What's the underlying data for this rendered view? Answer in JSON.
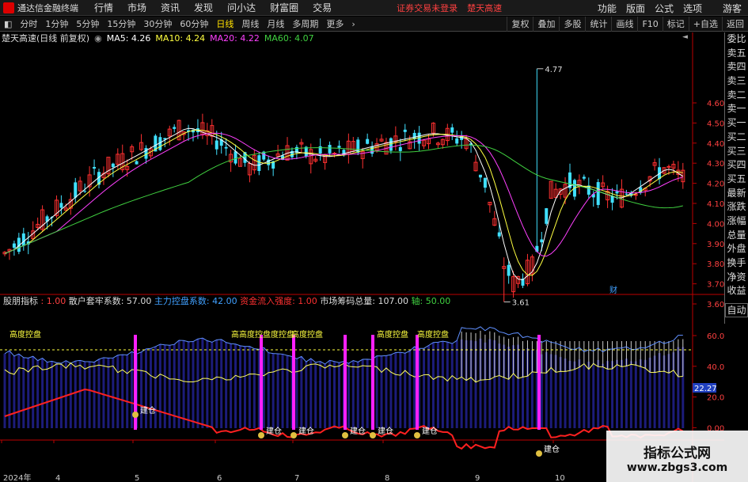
{
  "app_title": "通达信金融终端",
  "menus": [
    "行情",
    "市场",
    "资讯",
    "发现",
    "问小达",
    "财富圈",
    "交易"
  ],
  "notices": [
    "证券交易未登录",
    "楚天高速"
  ],
  "menus_right": [
    "功能",
    "版面",
    "公式",
    "选项",
    "游客"
  ],
  "tabs": [
    "分时",
    "1分钟",
    "5分钟",
    "15分钟",
    "30分钟",
    "60分钟",
    "日线",
    "周线",
    "月线",
    "多周期",
    "更多"
  ],
  "tabs_right": [
    "复权",
    "叠加",
    "多股",
    "统计",
    "画线",
    "F10",
    "标记",
    "+自选",
    "返回"
  ],
  "stock_name": "楚天高速",
  "period_info": "(日线 前复权)",
  "ma": {
    "ma5": "MA5: 4.26",
    "ma10": "MA10: 4.24",
    "ma20": "MA20: 4.22",
    "ma60": "MA60: 4.07"
  },
  "price_axis": [
    "4.60",
    "4.50",
    "4.40",
    "4.30",
    "4.20",
    "4.10",
    "4.00",
    "3.90",
    "3.80",
    "3.70",
    "3.60"
  ],
  "high_label": "4.77",
  "low_label": "3.61",
  "finance_mark": "财",
  "indicator": {
    "name": "股朋指标",
    "v1": ": 1.00",
    "sanhu": "散户套牢系数: 57.00",
    "zhuli": "主力控盘系数: 42.00",
    "zijin": "资金流入强度: 1.00",
    "choumao": "市场筹码总量: 107.00",
    "zhou": "轴: 50.00"
  },
  "ind_axis": [
    "60.00",
    "40.00",
    "20.00",
    "0.00"
  ],
  "ind_current": "22.27",
  "gaodu_label": "高度控盘",
  "gaodu_multi": "高高度控盘度控盘",
  "jiancang": "建仓",
  "time_axis": [
    "2024年",
    "4",
    "5",
    "6",
    "7",
    "8",
    "9",
    "10"
  ],
  "right_panel": [
    "委比",
    "卖五",
    "卖四",
    "卖三",
    "卖二",
    "卖一",
    "买一",
    "买二",
    "买三",
    "买四",
    "买五",
    "最新",
    "涨跌",
    "涨幅",
    "总量",
    "外盘",
    "换手",
    "净资",
    "收益"
  ],
  "auto_label": "自动",
  "watermark": {
    "title": "指标公式网",
    "url": "www.zbgs3.com"
  },
  "colors": {
    "up": "#ff3030",
    "down": "#40e0ff",
    "ma5": "#ffffff",
    "ma10": "#ffff40",
    "ma20": "#ff40ff",
    "ma60": "#40d040"
  }
}
